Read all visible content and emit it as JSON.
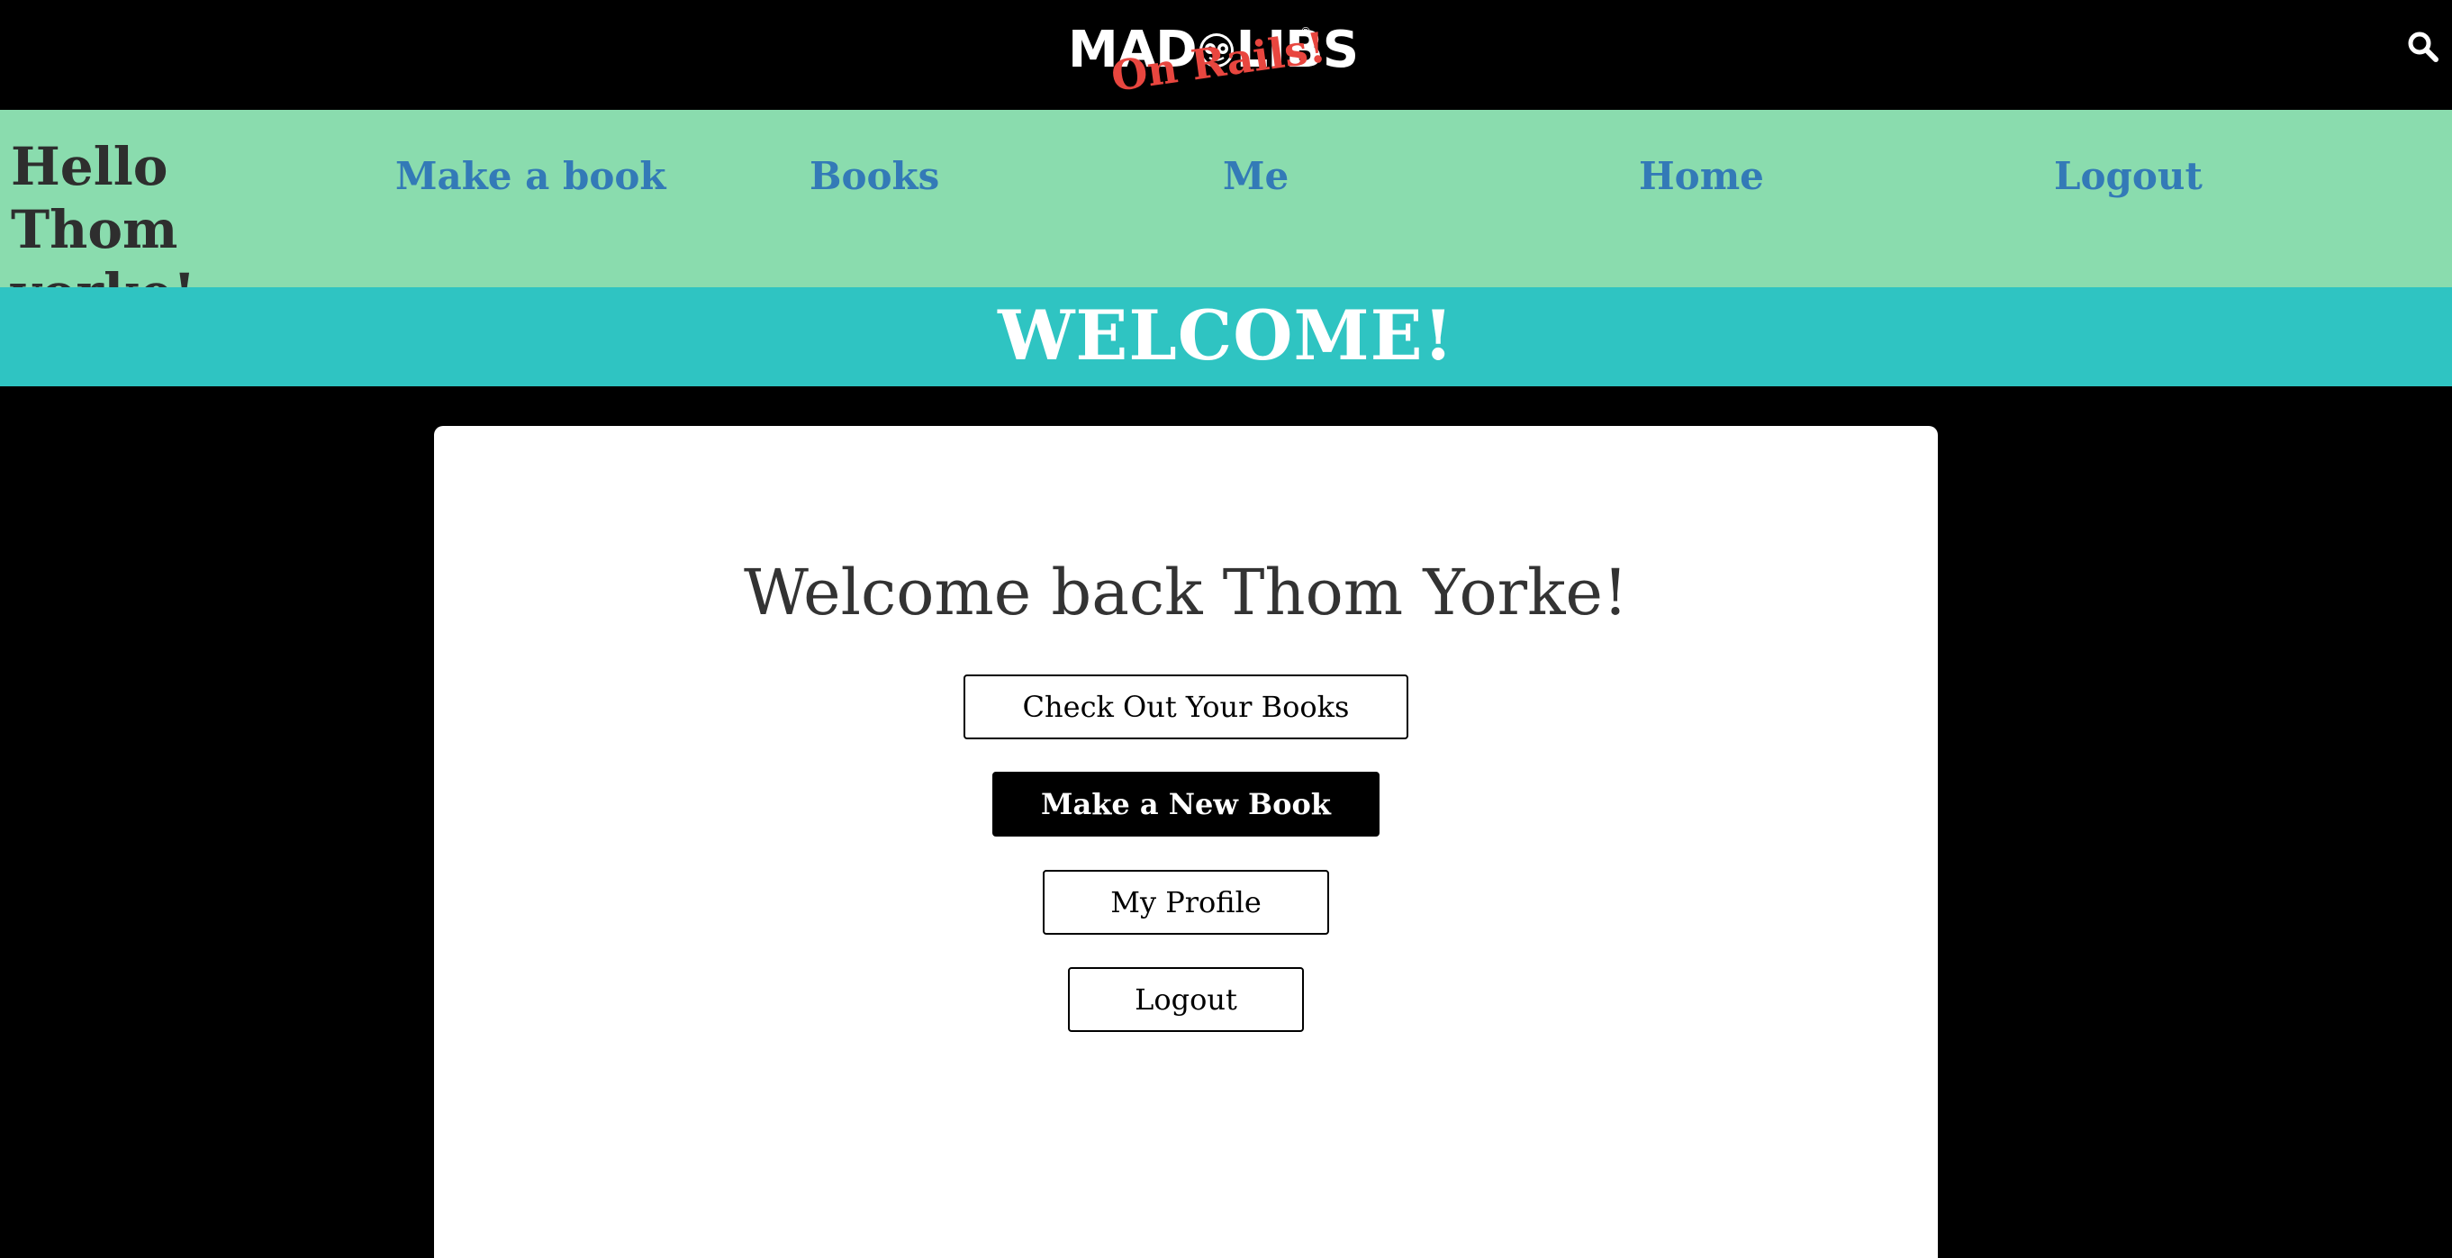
{
  "header": {
    "logo_main": "MAD",
    "logo_main_right": "LIBS",
    "logo_registered": "®",
    "logo_sub": "On Rails!",
    "search_icon": "search-icon"
  },
  "nav": {
    "greeting": "Hello Thom yorke!",
    "links": [
      "Make a book",
      "Books",
      "Me",
      "Home",
      "Logout"
    ]
  },
  "banner": {
    "title": "WELCOME!"
  },
  "card": {
    "heading": "Welcome back Thom Yorke!",
    "buttons": [
      "Check Out Your Books",
      "Make a New Book",
      "My Profile",
      "Logout"
    ]
  },
  "colors": {
    "topbar": "#000000",
    "navbar": "#8adcae",
    "nav_link": "#337ab7",
    "banner": "#2fc4c2",
    "logo_accent": "#e8463f",
    "card": "#ffffff"
  }
}
